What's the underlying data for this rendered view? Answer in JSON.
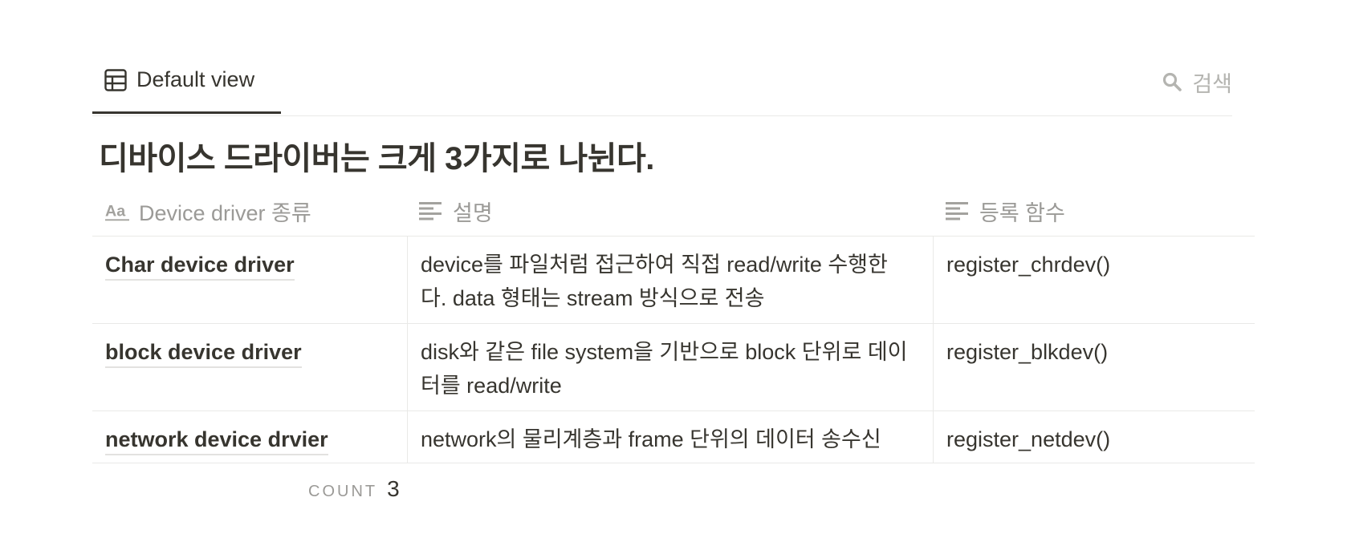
{
  "view": {
    "tab_label": "Default view",
    "search_label": "검색"
  },
  "database": {
    "title": "디바이스 드라이버는 크게 3가지로 나뉜다."
  },
  "table": {
    "columns": [
      {
        "label": "Device driver 종류",
        "icon": "title-property-icon"
      },
      {
        "label": "설명",
        "icon": "text-property-icon"
      },
      {
        "label": "등록 함수",
        "icon": "text-property-icon"
      }
    ],
    "rows": [
      {
        "name": "Char device driver",
        "description": "device를 파일처럼 접근하여 직접 read/write 수행한다. data 형태는 stream 방식으로 전송",
        "function": "register_chrdev()"
      },
      {
        "name": "block device driver",
        "description": "disk와 같은 file system을 기반으로 block 단위로 데이터를 read/write",
        "function": "register_blkdev()"
      },
      {
        "name": "network device drvier",
        "description": "network의 물리계층과 frame 단위의 데이터 송수신",
        "function": "register_netdev()"
      }
    ]
  },
  "footer": {
    "count_label": "COUNT",
    "count_value": "3"
  }
}
